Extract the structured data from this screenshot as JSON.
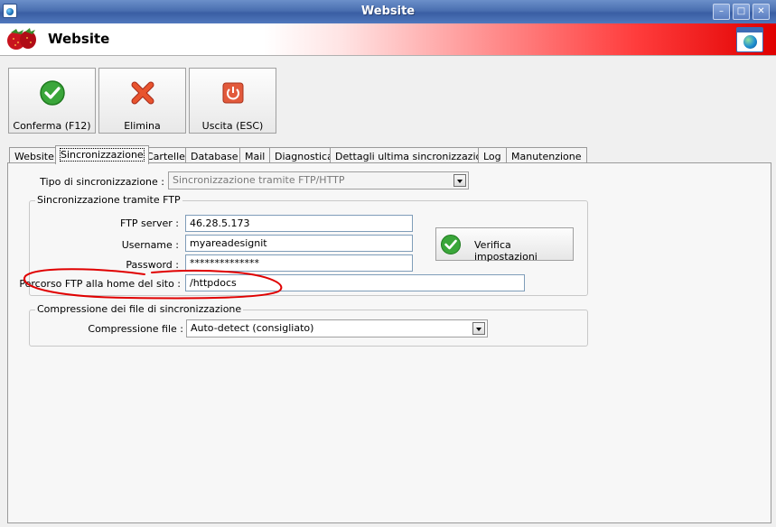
{
  "window": {
    "title": "Website"
  },
  "banner": {
    "title": "Website"
  },
  "toolbar": {
    "confirm_label": "Conferma (F12)",
    "delete_label": "Elimina",
    "exit_label": "Uscita (ESC)"
  },
  "tabs": [
    {
      "label": "Website"
    },
    {
      "label": "Sincronizzazione"
    },
    {
      "label": "Cartelle"
    },
    {
      "label": "Database"
    },
    {
      "label": "Mail"
    },
    {
      "label": "Diagnostica"
    },
    {
      "label": "Dettagli ultima sincronizzazione"
    },
    {
      "label": "Log"
    },
    {
      "label": "Manutenzione"
    }
  ],
  "sync": {
    "type_label": "Tipo di sincronizzazione :",
    "type_value": "Sincronizzazione tramite FTP/HTTP",
    "ftp_group_title": "Sincronizzazione tramite FTP",
    "ftp_server_label": "FTP server :",
    "ftp_server_value": "46.28.5.173",
    "username_label": "Username :",
    "username_value": "myareadesignit",
    "password_label": "Password :",
    "password_value": "**************",
    "path_label": "Percorso FTP alla home del sito :",
    "path_value": "/httpdocs",
    "verify_label": "Verifica impostazioni",
    "compression_group_title": "Compressione dei file di sincronizzazione",
    "compression_label": "Compressione file :",
    "compression_value": "Auto-detect (consigliato)"
  },
  "colors": {
    "title_bar": "#4a6fb0",
    "banner_red": "#e00000",
    "annotation": "#e00000"
  }
}
